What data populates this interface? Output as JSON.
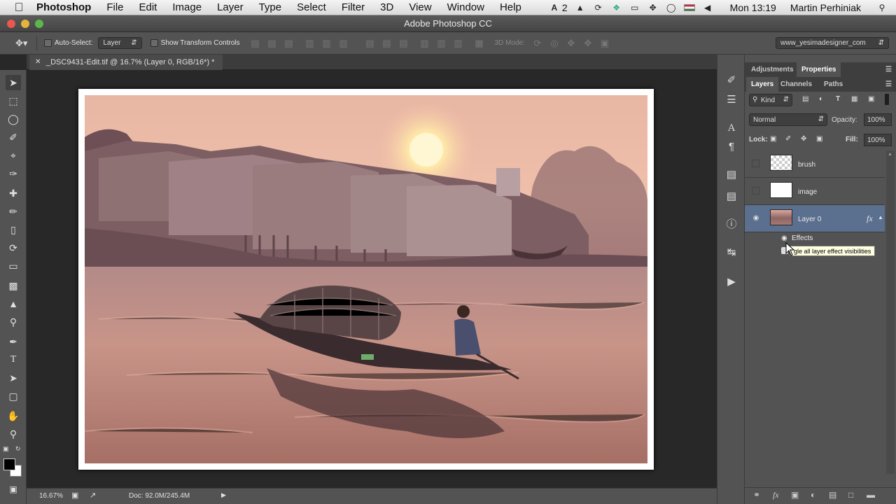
{
  "menubar": {
    "apple_icon": "apple-logo",
    "app_name": "Photoshop",
    "items": [
      "File",
      "Edit",
      "Image",
      "Layer",
      "Type",
      "Select",
      "Filter",
      "3D",
      "View",
      "Window",
      "Help"
    ],
    "adobe_badge": "2",
    "clock": "Mon 13:19",
    "user": "Martin Perhiniak"
  },
  "window": {
    "title": "Adobe Photoshop CC"
  },
  "options": {
    "auto_select_label": "Auto-Select:",
    "auto_select_value": "Layer",
    "transform_label": "Show Transform Controls",
    "mode_3d_label": "3D Mode:",
    "workspace": "www_yesimadesigner_com"
  },
  "document": {
    "tab_title": "_DSC9431-Edit.tif @ 16.7% (Layer 0, RGB/16*) *",
    "zoom": "16.67%",
    "doc_info": "Doc: 92.0M/245.4M"
  },
  "panels": {
    "top_tabs": [
      "Adjustments",
      "Properties"
    ],
    "layer_tabs": [
      "Layers",
      "Channels",
      "Paths"
    ],
    "kind_label": "Kind",
    "blend_mode": "Normal",
    "opacity_label": "Opacity:",
    "opacity_value": "100%",
    "lock_label": "Lock:",
    "fill_label": "Fill:",
    "fill_value": "100%",
    "layers": [
      {
        "name": "brush",
        "visible": false
      },
      {
        "name": "image",
        "visible": false
      },
      {
        "name": "Layer 0",
        "visible": true,
        "fx": "fx"
      }
    ],
    "effects_label": "Effects",
    "tooltip": "gle all layer effect visibilities"
  },
  "colors": {
    "accent_selected_layer": "#5b6f8e",
    "panel_bg": "#535353"
  }
}
